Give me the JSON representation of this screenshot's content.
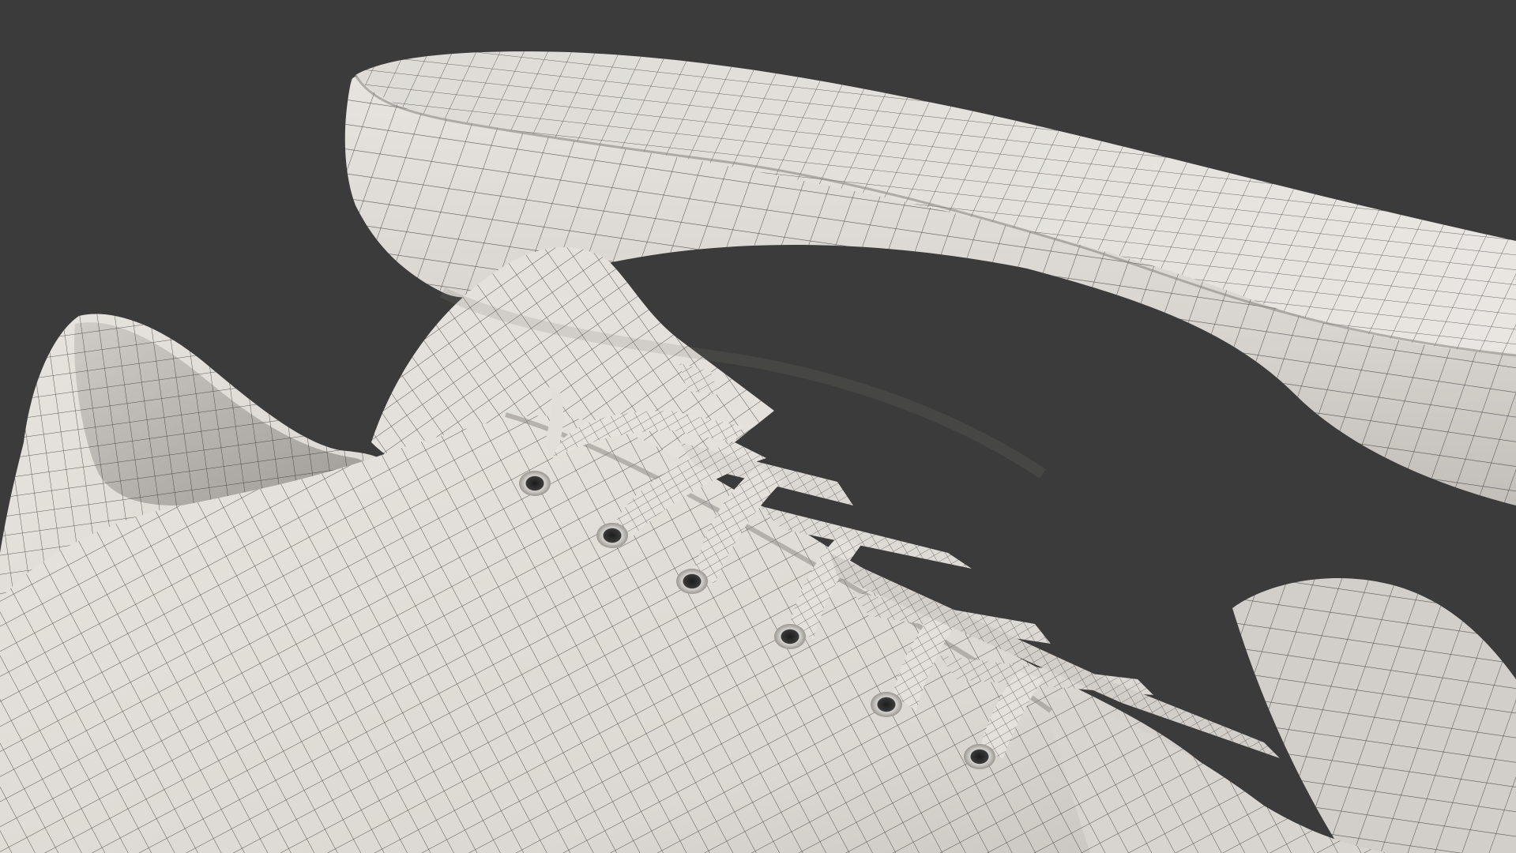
{
  "scene": {
    "kind": "3d-wireframe-render",
    "subject": "sneaker-mesh",
    "colors": {
      "background": "#3b3b3b",
      "clay_light": "#e6e3de",
      "clay_mid": "#c9c6c1",
      "clay_shadow": "#9d9a96",
      "wire": "#2a2a2a"
    },
    "lace_count": 7,
    "eyelet_count": 6
  }
}
